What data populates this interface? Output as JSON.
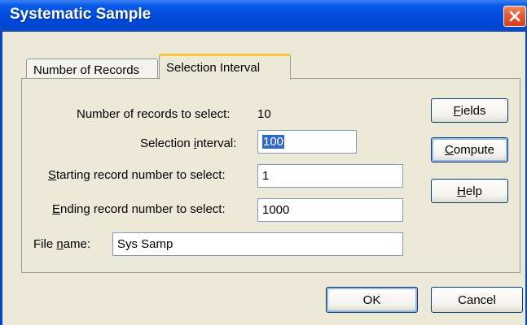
{
  "window": {
    "title": "Systematic Sample"
  },
  "tabs": [
    {
      "label": "Number of Records"
    },
    {
      "label": "Selection Interval",
      "active": true
    }
  ],
  "form": {
    "records_to_select_label": "Number of records to select:",
    "records_to_select_value": "10",
    "selection_interval_label_pre": "Selection ",
    "selection_interval_label_key": "i",
    "selection_interval_label_post": "nterval:",
    "selection_interval_value": "100",
    "starting_label_key": "S",
    "starting_label_post": "tarting record number to select:",
    "starting_value": "1",
    "ending_label_key": "E",
    "ending_label_post": "nding record number to select:",
    "ending_value": "1000",
    "file_name_label_pre": "File ",
    "file_name_label_key": "n",
    "file_name_label_post": "ame:",
    "file_name_value": "Sys Samp"
  },
  "side_buttons": {
    "fields_key": "F",
    "fields_rest": "ields",
    "compute_key": "C",
    "compute_rest": "ompute",
    "help_key": "H",
    "help_rest": "elp"
  },
  "footer": {
    "ok_label": "OK",
    "cancel_label": "Cancel"
  },
  "icons": {
    "close": "close-x-icon"
  },
  "colors": {
    "titlebar": "#0046d2",
    "close_button": "#e25a33",
    "selection": "#316ac5",
    "active_tab_accent": "#ffc83c"
  }
}
